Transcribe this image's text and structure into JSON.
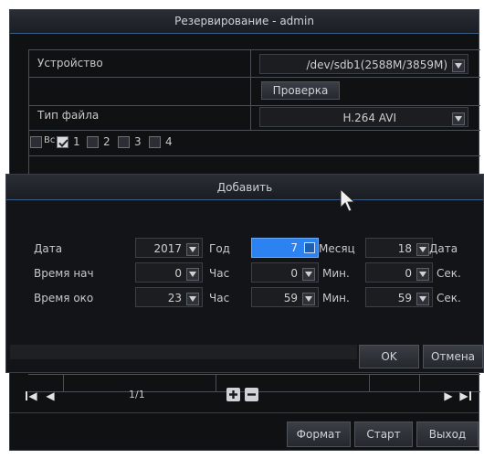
{
  "backup": {
    "title": "Резервирование - admin",
    "device_label": "Устройство",
    "device_value": "/dev/sdb1(2588M/3859M)",
    "check_button": "Проверка",
    "file_type_label": "Тип файла",
    "file_type_value": "H.264 AVI",
    "channels": [
      {
        "label": "Все",
        "checked": false
      },
      {
        "label": "1",
        "checked": true
      },
      {
        "label": "2",
        "checked": false
      },
      {
        "label": "3",
        "checked": false
      },
      {
        "label": "4",
        "checked": false
      }
    ]
  },
  "add": {
    "title": "Добавить",
    "date_label": "Дата",
    "start_label": "Время нач",
    "end_label": "Время око",
    "date": {
      "year": "2017",
      "year_unit": "Год",
      "month": "7",
      "month_unit": "Месяц",
      "day": "18",
      "day_unit": "Дата"
    },
    "start": {
      "hour": "0",
      "hour_unit": "Час",
      "min": "0",
      "min_unit": "Мин.",
      "sec": "0",
      "sec_unit": "Сек."
    },
    "end": {
      "hour": "23",
      "hour_unit": "Час",
      "min": "59",
      "min_unit": "Мин.",
      "sec": "59",
      "sec_unit": "Сек."
    },
    "ok_button": "OK",
    "cancel_button": "Отмена"
  },
  "bottom": {
    "page_indicator": "1/1",
    "format_button": "Формат",
    "start_button": "Старт",
    "exit_button": "Выход"
  },
  "colors": {
    "highlight": "#2b82f0",
    "accent_line": "#3b5f86"
  }
}
